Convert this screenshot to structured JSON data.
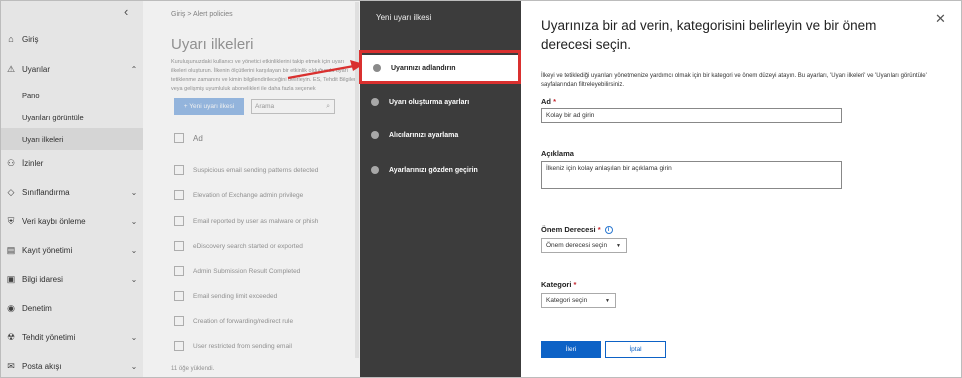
{
  "nav": {
    "collapse_glyph": "‹",
    "items": [
      {
        "label": "Giriş",
        "icon": "home-icon",
        "glyph": "⌂",
        "chevron": ""
      },
      {
        "label": "Uyarılar",
        "icon": "warning-icon",
        "glyph": "⚠",
        "chevron": "⌃"
      },
      {
        "label": "İzinler",
        "icon": "people-icon",
        "glyph": "⚇",
        "chevron": ""
      },
      {
        "label": "Sınıflandırma",
        "icon": "tag-icon",
        "glyph": "🏷",
        "chevron": "⌄"
      },
      {
        "label": "Veri kaybı önleme",
        "icon": "shield-icon",
        "glyph": "⛨",
        "chevron": "⌄"
      },
      {
        "label": "Kayıt yönetimi",
        "icon": "records-icon",
        "glyph": "▤",
        "chevron": "⌄"
      },
      {
        "label": "Bilgi idaresi",
        "icon": "lock-icon",
        "glyph": "🔒",
        "chevron": "⌄"
      },
      {
        "label": "Denetim",
        "icon": "eye-icon",
        "glyph": "◉",
        "chevron": ""
      },
      {
        "label": "Tehdit yönetimi",
        "icon": "bug-icon",
        "glyph": "☢",
        "chevron": "⌄"
      },
      {
        "label": "Posta akışı",
        "icon": "mail-icon",
        "glyph": "✉",
        "chevron": "⌄"
      }
    ],
    "sub_items": [
      {
        "label": "Pano"
      },
      {
        "label": "Uyarıları görüntüle"
      },
      {
        "label": "Uyarı ilkeleri"
      }
    ]
  },
  "page": {
    "breadcrumb": "Giriş  >  Alert policies",
    "title": "Uyarı ilkeleri",
    "description": "Kuruluşunuzdaki kullanıcı ve yönetici etkinliklerini takip etmek için uyarı ilkeleri oluşturun. İlkenin ölçütlerini karşılayan bir etkinlik olduğunda uyarı tetiklenme zamanını ve kimin bilgilendirileceğini belirleyin. ES, Tehdit Bilgileri veya gelişmiş uyumluluk abonelikleri ile daha fazla seçenek",
    "new_button": "+ Yeni uyarı ilkesi",
    "search_placeholder": "Arama",
    "search_glyph": "⌕",
    "column_header": "Ad",
    "rows": [
      "Suspicious email sending patterns detected",
      "Elevation of Exchange admin privilege",
      "Email reported by user as malware or phish",
      "eDiscovery search started or exported",
      "Admin Submission Result Completed",
      "Email sending limit exceeded",
      "Creation of forwarding/redirect rule",
      "User restricted from sending email"
    ],
    "footer": "11 öğe yüklendi."
  },
  "wizard": {
    "panel_title": "Yeni uyarı ilkesi",
    "steps": [
      {
        "label": "Uyarınızı adlandırın",
        "current": true
      },
      {
        "label": "Uyarı oluşturma ayarları",
        "current": false
      },
      {
        "label": "Alıcılarınızı ayarlama",
        "current": false
      },
      {
        "label": "Ayarlarınızı gözden geçirin",
        "current": false
      }
    ],
    "close_glyph": "✕",
    "heading": "Uyarınıza bir ad verin, kategorisini belirleyin ve bir önem derecesi seçin.",
    "intro": "İlkeyi ve tetiklediği uyarıları yönetmenize yardımcı olmak için bir kategori ve önem düzeyi atayın. Bu ayarları, 'Uyarı ilkeleri' ve 'Uyarıları görüntüle' sayfalarından filtreleyebilirsiniz.",
    "name_label": "Ad",
    "name_required": "*",
    "name_placeholder": "Kolay bir ad girin",
    "description_label": "Açıklama",
    "description_placeholder": "İlkeniz için kolay anlaşılan bir açıklama girin",
    "severity_label": "Önem Derecesi",
    "severity_required": "*",
    "severity_info_glyph": "i",
    "severity_value": "Önem derecesi seçin",
    "category_label": "Kategori",
    "category_required": "*",
    "category_value": "Kategori seçin",
    "caret_glyph": "▼",
    "next_button": "İleri",
    "cancel_button": "İptal"
  },
  "colors": {
    "step_panel": "#3c3c3c",
    "highlight": "#d9302f",
    "primary": "#0d62c6"
  }
}
